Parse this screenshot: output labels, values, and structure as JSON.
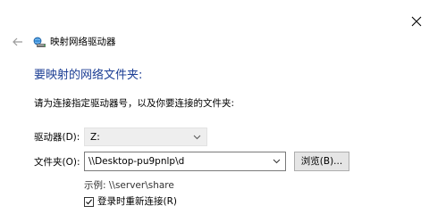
{
  "window": {
    "title": "映射网络驱动器"
  },
  "heading": "要映射的网络文件夹:",
  "subtitle": "请为连接指定驱动器号，以及你要连接的文件夹:",
  "drive": {
    "label": "驱动器(D):",
    "value": "Z:"
  },
  "folder": {
    "label": "文件夹(O):",
    "value": "\\\\Desktop-pu9pnlp\\d",
    "browse_label": "浏览(B)..."
  },
  "example": "示例: \\\\server\\share",
  "reconnect": {
    "label": "登录时重新连接(R)",
    "checked": true
  },
  "icons": {
    "close": "close-icon",
    "back": "back-arrow-icon",
    "app": "network-drive-icon",
    "dropdown": "chevron-down-icon",
    "check": "checkmark-icon"
  },
  "colors": {
    "heading": "#1c3e94",
    "drive_select_bg": "#eeeeee",
    "button_bg": "#e5e5e5"
  }
}
